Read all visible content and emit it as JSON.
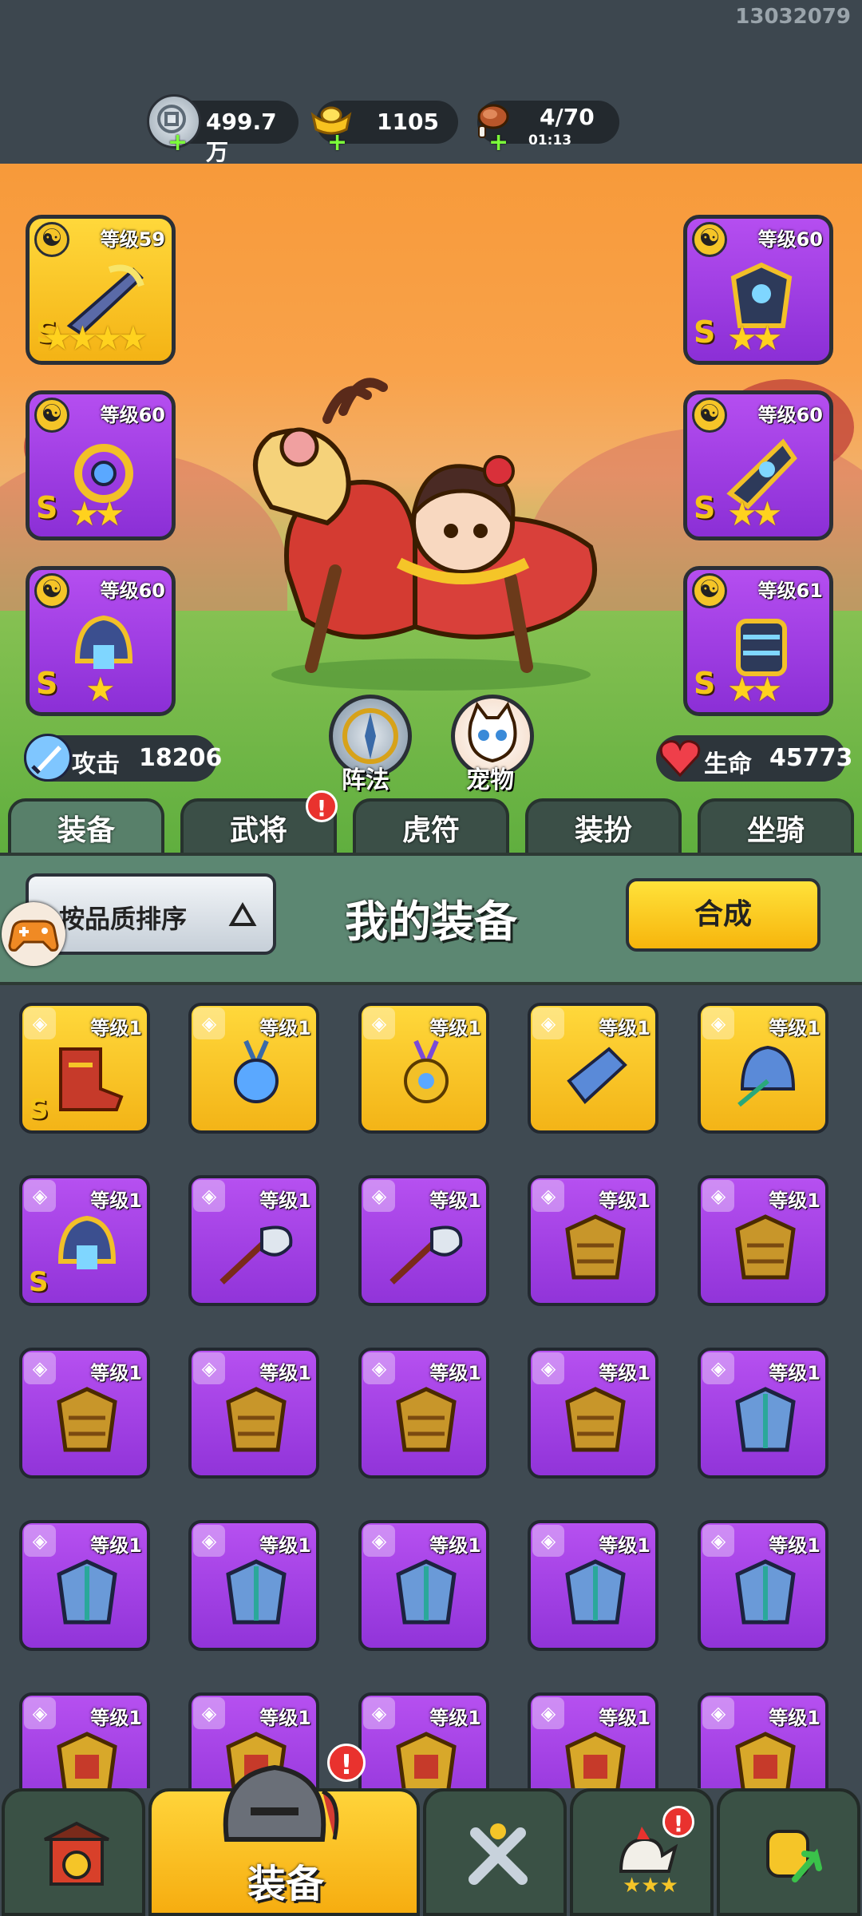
{
  "status": {
    "user_id": "13032079"
  },
  "resources": [
    {
      "icon": "silver-coin-icon",
      "value": "499.7万"
    },
    {
      "icon": "gold-ingot-icon",
      "value": "1105"
    },
    {
      "icon": "meat-stamina-icon",
      "value": "4/70",
      "timer": "01:13"
    }
  ],
  "equipped_left": [
    {
      "level": "等级59",
      "grade": "S",
      "stars": "★★★★",
      "frame": "gold",
      "icon": "dragon-blade-icon"
    },
    {
      "level": "等级60",
      "grade": "S",
      "stars": "★★",
      "frame": "purple",
      "icon": "dragon-necklace-icon"
    },
    {
      "level": "等级60",
      "grade": "S",
      "stars": "★",
      "frame": "purple",
      "icon": "dragon-helmet-icon"
    }
  ],
  "equipped_right": [
    {
      "level": "等级60",
      "grade": "S",
      "stars": "★★",
      "frame": "purple",
      "icon": "dragon-armor-icon"
    },
    {
      "level": "等级60",
      "grade": "S",
      "stars": "★★",
      "frame": "purple",
      "icon": "dragon-gauntlet-icon"
    },
    {
      "level": "等级61",
      "grade": "S",
      "stars": "★★",
      "frame": "purple",
      "icon": "dragon-boots-icon"
    }
  ],
  "stats": {
    "attack_label": "攻击",
    "attack_value": "18206",
    "hp_label": "生命",
    "hp_value": "45773"
  },
  "round_buttons": {
    "formation": "阵法",
    "pet": "宠物"
  },
  "tabs": [
    {
      "label": "装备",
      "active": true
    },
    {
      "label": "武将",
      "badge": "!"
    },
    {
      "label": "虎符"
    },
    {
      "label": "装扮"
    },
    {
      "label": "坐骑"
    }
  ],
  "inventory_header": {
    "sort_label": "按品质排序",
    "title": "我的装备",
    "compose_label": "合成"
  },
  "inventory": [
    {
      "level": "等级1",
      "frame": "gold",
      "grade": "S",
      "icon": "red-boots-icon"
    },
    {
      "level": "等级1",
      "frame": "gold",
      "icon": "blue-medal-icon"
    },
    {
      "level": "等级1",
      "frame": "gold",
      "icon": "gold-medal-icon"
    },
    {
      "level": "等级1",
      "frame": "gold",
      "icon": "blue-gauntlet-icon"
    },
    {
      "level": "等级1",
      "frame": "gold",
      "icon": "blue-helmet-icon"
    },
    {
      "level": "等级1",
      "frame": "purple",
      "grade": "S",
      "icon": "dragon-helmet-icon"
    },
    {
      "level": "等级1",
      "frame": "purple",
      "icon": "guandao-blade-icon"
    },
    {
      "level": "等级1",
      "frame": "purple",
      "icon": "guandao-blade-icon"
    },
    {
      "level": "等级1",
      "frame": "purple",
      "icon": "bronze-armor-icon"
    },
    {
      "level": "等级1",
      "frame": "purple",
      "icon": "bronze-armor-icon"
    },
    {
      "level": "等级1",
      "frame": "purple",
      "icon": "bronze-armor-icon"
    },
    {
      "level": "等级1",
      "frame": "purple",
      "icon": "bronze-armor-icon"
    },
    {
      "level": "等级1",
      "frame": "purple",
      "icon": "bronze-armor-icon"
    },
    {
      "level": "等级1",
      "frame": "purple",
      "icon": "bronze-armor-icon"
    },
    {
      "level": "等级1",
      "frame": "purple",
      "icon": "blue-armor-icon"
    },
    {
      "level": "等级1",
      "frame": "purple",
      "icon": "blue-armor-icon"
    },
    {
      "level": "等级1",
      "frame": "purple",
      "icon": "blue-armor-icon"
    },
    {
      "level": "等级1",
      "frame": "purple",
      "icon": "blue-armor-icon"
    },
    {
      "level": "等级1",
      "frame": "purple",
      "icon": "blue-armor-icon"
    },
    {
      "level": "等级1",
      "frame": "purple",
      "icon": "blue-armor-icon"
    },
    {
      "level": "等级1",
      "frame": "purple",
      "icon": "red-gold-armor-icon"
    },
    {
      "level": "等级1",
      "frame": "purple",
      "icon": "red-gold-armor-icon"
    },
    {
      "level": "等级1",
      "frame": "purple",
      "icon": "red-gold-armor-icon"
    },
    {
      "level": "等级1",
      "frame": "purple",
      "icon": "red-gold-armor-icon"
    },
    {
      "level": "等级1",
      "frame": "purple",
      "icon": "red-gold-armor-icon"
    }
  ],
  "bottom_nav": [
    {
      "icon": "city-gate-icon"
    },
    {
      "label": "装备",
      "icon": "knight-helmet-icon",
      "active": true,
      "badge": "!"
    },
    {
      "icon": "crossed-swords-icon"
    },
    {
      "icon": "rooster-icon",
      "badge": "!"
    },
    {
      "icon": "fist-growth-icon"
    }
  ],
  "colors": {
    "gold_frame": "#f7c21f",
    "purple_frame": "#a640e6",
    "tab_active": "#58806a",
    "badge_red": "#e9322e"
  }
}
